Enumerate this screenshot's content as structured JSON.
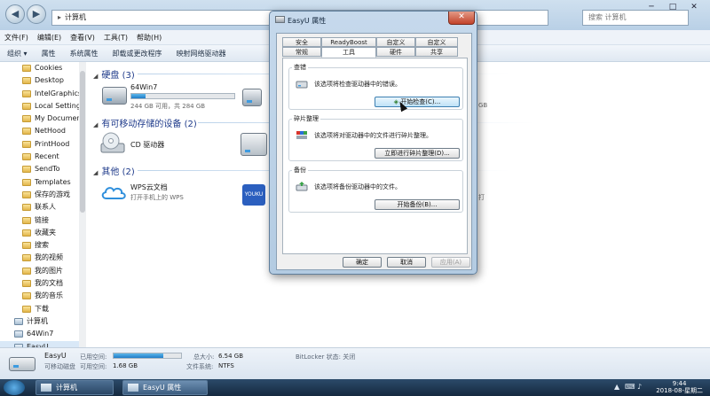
{
  "explorer": {
    "address": "计算机",
    "search_placeholder": "搜索 计算机",
    "menu": [
      "文件(F)",
      "编辑(E)",
      "查看(V)",
      "工具(T)",
      "帮助(H)"
    ],
    "toolbar": [
      "组织 ▾",
      "属性",
      "系统属性",
      "卸载或更改程序",
      "映射网络驱动器"
    ],
    "sidebar": [
      {
        "label": "Cookies",
        "type": "folder"
      },
      {
        "label": "Desktop",
        "type": "folder"
      },
      {
        "label": "IntelGraphicsI",
        "type": "folder"
      },
      {
        "label": "Local Settings",
        "type": "folder"
      },
      {
        "label": "My Document",
        "type": "folder"
      },
      {
        "label": "NetHood",
        "type": "folder"
      },
      {
        "label": "PrintHood",
        "type": "folder"
      },
      {
        "label": "Recent",
        "type": "folder"
      },
      {
        "label": "SendTo",
        "type": "folder"
      },
      {
        "label": "Templates",
        "type": "folder"
      },
      {
        "label": "保存的游戏",
        "type": "folder"
      },
      {
        "label": "联系人",
        "type": "folder"
      },
      {
        "label": "链接",
        "type": "folder"
      },
      {
        "label": "收藏夹",
        "type": "folder"
      },
      {
        "label": "搜索",
        "type": "folder"
      },
      {
        "label": "我的视频",
        "type": "folder"
      },
      {
        "label": "我的图片",
        "type": "folder"
      },
      {
        "label": "我的文档",
        "type": "folder"
      },
      {
        "label": "我的音乐",
        "type": "folder"
      },
      {
        "label": "下载",
        "type": "folder"
      },
      {
        "label": "计算机",
        "type": "computer"
      },
      {
        "label": "64Win7",
        "type": "drive"
      },
      {
        "label": "EasyU",
        "type": "drive"
      }
    ],
    "groups": {
      "hdd": "硬盘 (3)",
      "removable": "有可移动存储的设备 (2)",
      "other": "其他 (2)"
    },
    "drives": {
      "win7": {
        "name": "64Win7",
        "detail": "244 GB 可用，共 284 GB",
        "used_fraction": 0.14
      },
      "right_detail": "GB",
      "cd": {
        "name": "CD 驱动器"
      },
      "wps": {
        "name": "WPS云文档",
        "detail": "打开手机上的 WPS",
        "detail_prefix": "打"
      }
    },
    "status": {
      "name": "EasyU",
      "used_label": "已用空间:",
      "free_label": "可用空间:",
      "free_value": "1.68 GB",
      "used_fraction": 0.74,
      "total_label": "总大小:",
      "total_value": "6.54 GB",
      "fs_label": "文件系统:",
      "fs_value": "NTFS",
      "bitlocker": "BitLocker 状态: 关闭"
    }
  },
  "dialog": {
    "title": "EasyU 属性",
    "tabs_row1": [
      "安全",
      "ReadyBoost",
      "自定义",
      "自定义"
    ],
    "tabs_row2": [
      "常规",
      "工具",
      "硬件",
      "共享"
    ],
    "sections": {
      "check": {
        "legend": "查错",
        "text": "该选项将检查驱动器中的错误。",
        "button": "开始检查(C)..."
      },
      "defrag": {
        "legend": "碎片整理",
        "text": "该选项将对驱动器中的文件进行碎片整理。",
        "button": "立即进行碎片整理(D)..."
      },
      "backup": {
        "legend": "备份",
        "text": "该选项将备份驱动器中的文件。",
        "button": "开始备份(B)..."
      }
    },
    "ok": "确定",
    "cancel": "取消",
    "apply": "应用(A)"
  },
  "taskbar": {
    "tasks": [
      "计算机",
      "EasyU 属性"
    ],
    "time": "9:44",
    "date": "2018-08-星期二"
  }
}
